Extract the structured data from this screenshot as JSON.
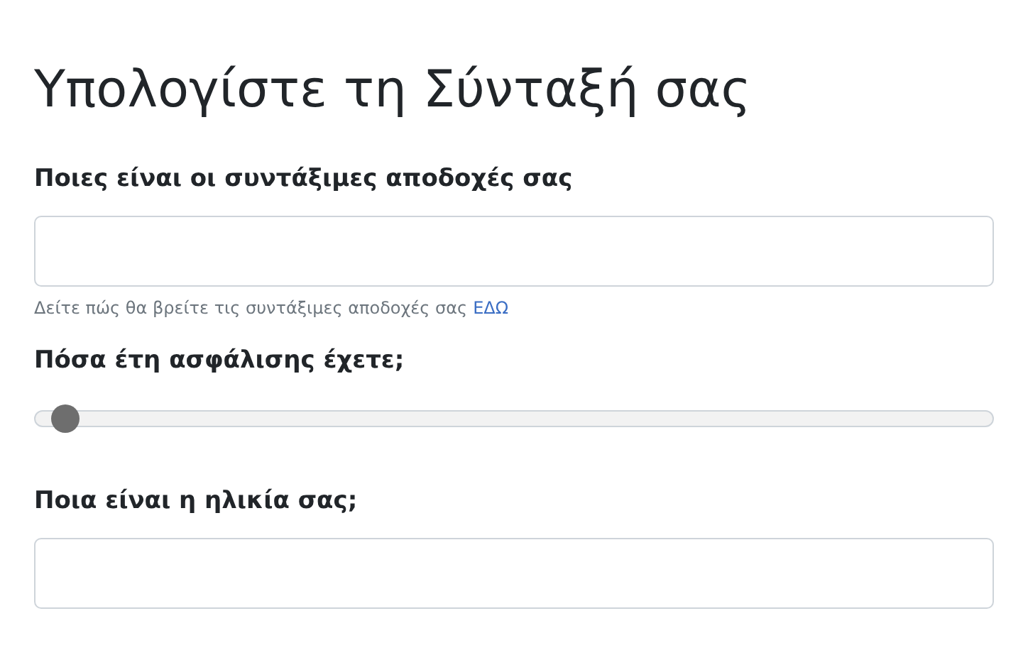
{
  "title": "Υπολογίστε τη Σύνταξή σας",
  "fields": [
    {
      "kind": "input",
      "label": "Ποιες είναι οι συντάξιμες αποδοχές σας",
      "hint": "Δείτε πώς θα βρείτε τις συντάξιμες αποδοχές σας",
      "hint_link": "ΕΔΩ"
    },
    {
      "kind": "slider",
      "label": "Πόσα έτη ασφάλισης έχετε;",
      "level": 0.02
    },
    {
      "kind": "input",
      "label": "Ποια είναι η ηλικία σας;"
    }
  ]
}
